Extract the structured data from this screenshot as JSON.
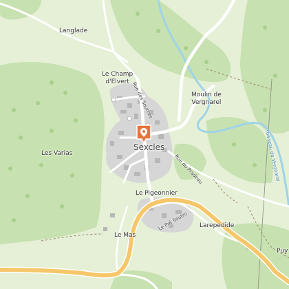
{
  "map": {
    "place_labels": {
      "langlade": "Langlade",
      "le_champ_delvert": "Le Champ\nd'Elvert",
      "moulin": "Moulin de\nVergnarel",
      "les_varias": "Les Varias",
      "le_pigeonnier": "Le Pigeonnier",
      "le_mas": "Le Mas",
      "larepedide": "Larepedide",
      "puy": "Puy"
    },
    "town_label": "Sexcles",
    "street_labels": {
      "rue_des_sources": "Rue des Sources",
      "rue_du_pradeau": "Rue du Pradeau",
      "le_pre_soutro": "Le Pré Soutro"
    },
    "river_label": "ruisseau de Vergnarel",
    "marker": {
      "icon": "map-pin-icon",
      "color": "#e8743b"
    },
    "colors": {
      "meadow": "#e5f0d6",
      "forest": "#c7e1b0",
      "water": "#9fd3e8",
      "main_road": "#f5c76a",
      "village": "#d6d6d6",
      "buildings": "#b7b7b7"
    }
  }
}
